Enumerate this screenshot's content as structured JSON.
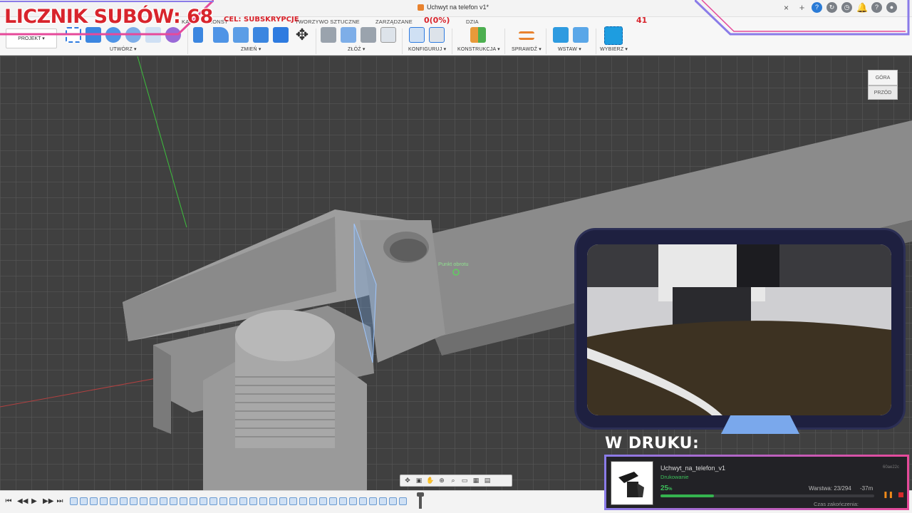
{
  "titlebar": {
    "document_title": "Uchwyt na telefon v1*",
    "close_symbol": "×",
    "icons": [
      "add-tab-icon",
      "help-icon",
      "sync-icon",
      "history-icon",
      "notification-icon",
      "question-icon",
      "user-avatar-icon"
    ]
  },
  "ribbon": {
    "tabs": [
      "KA",
      "KONST",
      "TWORZYWO SZTUCZNE",
      "ZARZĄDZANE",
      "DZIA"
    ],
    "project_button": "PROJEKT ▾",
    "groups": [
      {
        "id": "create",
        "label": "UTWÓRZ ▾"
      },
      {
        "id": "modify",
        "label": "ZMIEŃ ▾"
      },
      {
        "id": "assemble",
        "label": "ZŁÓŻ ▾"
      },
      {
        "id": "configure",
        "label": "KONFIGURUJ ▾"
      },
      {
        "id": "construct",
        "label": "KONSTRUKCJA ▾"
      },
      {
        "id": "inspect",
        "label": "SPRAWDŹ ▾"
      },
      {
        "id": "insert",
        "label": "WSTAW ▾"
      },
      {
        "id": "select",
        "label": "WYBIERZ ▾"
      }
    ]
  },
  "viewport": {
    "pivot_label": "Punkt obrotu",
    "viewcube": {
      "top": "GÓRA",
      "front": "PRZÓD"
    }
  },
  "overlay": {
    "sub_counter": "LICZNIK SUBÓW: 68",
    "goal_label": "CEL: SUBSKRYPCJE",
    "goal_value": "0(0%)",
    "goal_target": "41"
  },
  "print": {
    "heading": "W DRUKU:",
    "file_name": "Uchwyt_na_telefon_v1",
    "status": "Drukowanie",
    "id_code": "60ae22c",
    "percent": "25",
    "percent_unit": "%",
    "progress_fraction": 0.25,
    "layer": "Warstwa: 23/294",
    "remaining": "-37m",
    "finish_label": "Czas zakończenia:",
    "accent_green": "#35b34f"
  },
  "timeline": {
    "controls": [
      "⏮",
      "◀◀",
      "▶",
      "▶▶",
      "⏭"
    ],
    "feature_count": 34
  },
  "navbar": {
    "icons": [
      "orbit-icon",
      "look-at-icon",
      "pan-icon",
      "zoom-icon",
      "zoom-window-icon",
      "display-settings-icon",
      "grid-icon",
      "viewports-icon"
    ]
  }
}
